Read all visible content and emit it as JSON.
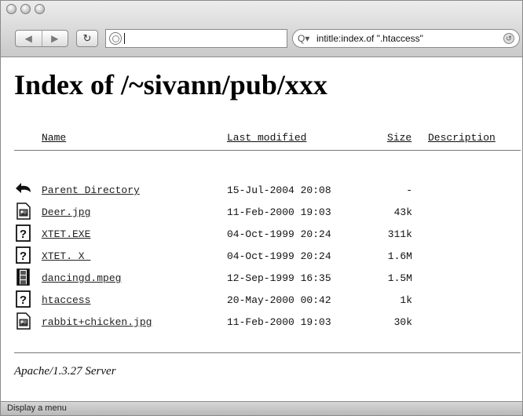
{
  "toolbar": {
    "back_label": "◀",
    "forward_label": "▶",
    "reload_label": "↻",
    "address_value": "",
    "search_prefix": "Q▾",
    "search_value": "intitle:index.of \".htaccess\""
  },
  "page": {
    "title": "Index of /~sivann/pub/xxx",
    "columns": {
      "name": "Name",
      "last_modified": "Last modified",
      "size": "Size",
      "description": "Description"
    },
    "rows": [
      {
        "icon": "back-arrow-icon",
        "name": "Parent Directory",
        "date": "15-Jul-2004 20:08",
        "size": "-"
      },
      {
        "icon": "image-file-icon",
        "name": "Deer.jpg",
        "date": "11-Feb-2000 19:03",
        "size": "43k"
      },
      {
        "icon": "unknown-file-icon",
        "name": "XTET.EXE",
        "date": "04-Oct-1999 20:24",
        "size": "311k"
      },
      {
        "icon": "unknown-file-icon",
        "name": "XTET._X_",
        "date": "04-Oct-1999 20:24",
        "size": "1.6M"
      },
      {
        "icon": "video-file-icon",
        "name": "dancingd.mpeg",
        "date": "12-Sep-1999 16:35",
        "size": "1.5M"
      },
      {
        "icon": "unknown-file-icon",
        "name": "htaccess",
        "date": "20-May-2000 00:42",
        "size": "1k"
      },
      {
        "icon": "image-file-icon",
        "name": "rabbit+chicken.jpg",
        "date": "11-Feb-2000 19:03",
        "size": "30k"
      }
    ],
    "server_signature": "Apache/1.3.27 Server"
  },
  "status": {
    "text": "Display a menu"
  }
}
